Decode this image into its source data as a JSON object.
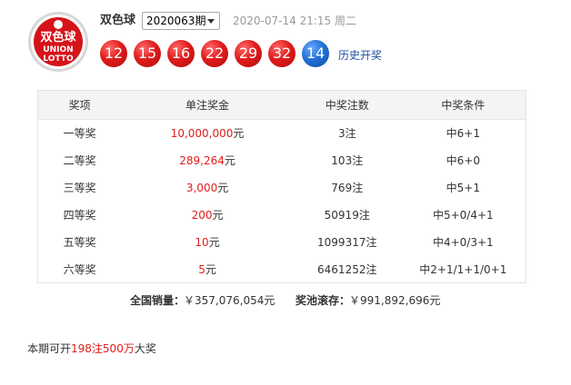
{
  "header": {
    "logo_text_top": "双色球",
    "logo_text_mid": "UNION",
    "logo_text_bottom": "LOTTO",
    "game_name": "双色球",
    "issue_selected": "2020063期",
    "draw_time": "2020-07-14 21:15 周二",
    "history_link": "历史开奖"
  },
  "balls": {
    "red": [
      "12",
      "15",
      "16",
      "22",
      "29",
      "32"
    ],
    "blue": [
      "14"
    ]
  },
  "table": {
    "headers": [
      "奖项",
      "单注奖金",
      "中奖注数",
      "中奖条件"
    ],
    "rows": [
      {
        "level": "一等奖",
        "amount": "10,000,000",
        "unit": "元",
        "count": "3注",
        "condition": "中6+1"
      },
      {
        "level": "二等奖",
        "amount": "289,264",
        "unit": "元",
        "count": "103注",
        "condition": "中6+0"
      },
      {
        "level": "三等奖",
        "amount": "3,000",
        "unit": "元",
        "count": "769注",
        "condition": "中5+1"
      },
      {
        "level": "四等奖",
        "amount": "200",
        "unit": "元",
        "count": "50919注",
        "condition": "中5+0/4+1"
      },
      {
        "level": "五等奖",
        "amount": "10",
        "unit": "元",
        "count": "1099317注",
        "condition": "中4+0/3+1"
      },
      {
        "level": "六等奖",
        "amount": "5",
        "unit": "元",
        "count": "6461252注",
        "condition": "中2+1/1+1/0+1"
      }
    ]
  },
  "summary": {
    "sales_label": "全国销量：",
    "sales_value": "￥357,076,054元",
    "pool_label": "奖池滚存：",
    "pool_value": "￥991,892,696元"
  },
  "bottom": {
    "prefix": "本期可开",
    "count": "198注",
    "amount": "500万",
    "suffix": "大奖"
  },
  "colors": {
    "red_ball": "#e01c1c",
    "blue_ball": "#2271d6",
    "highlight": "#e21c1c",
    "link": "#1e50a2"
  }
}
